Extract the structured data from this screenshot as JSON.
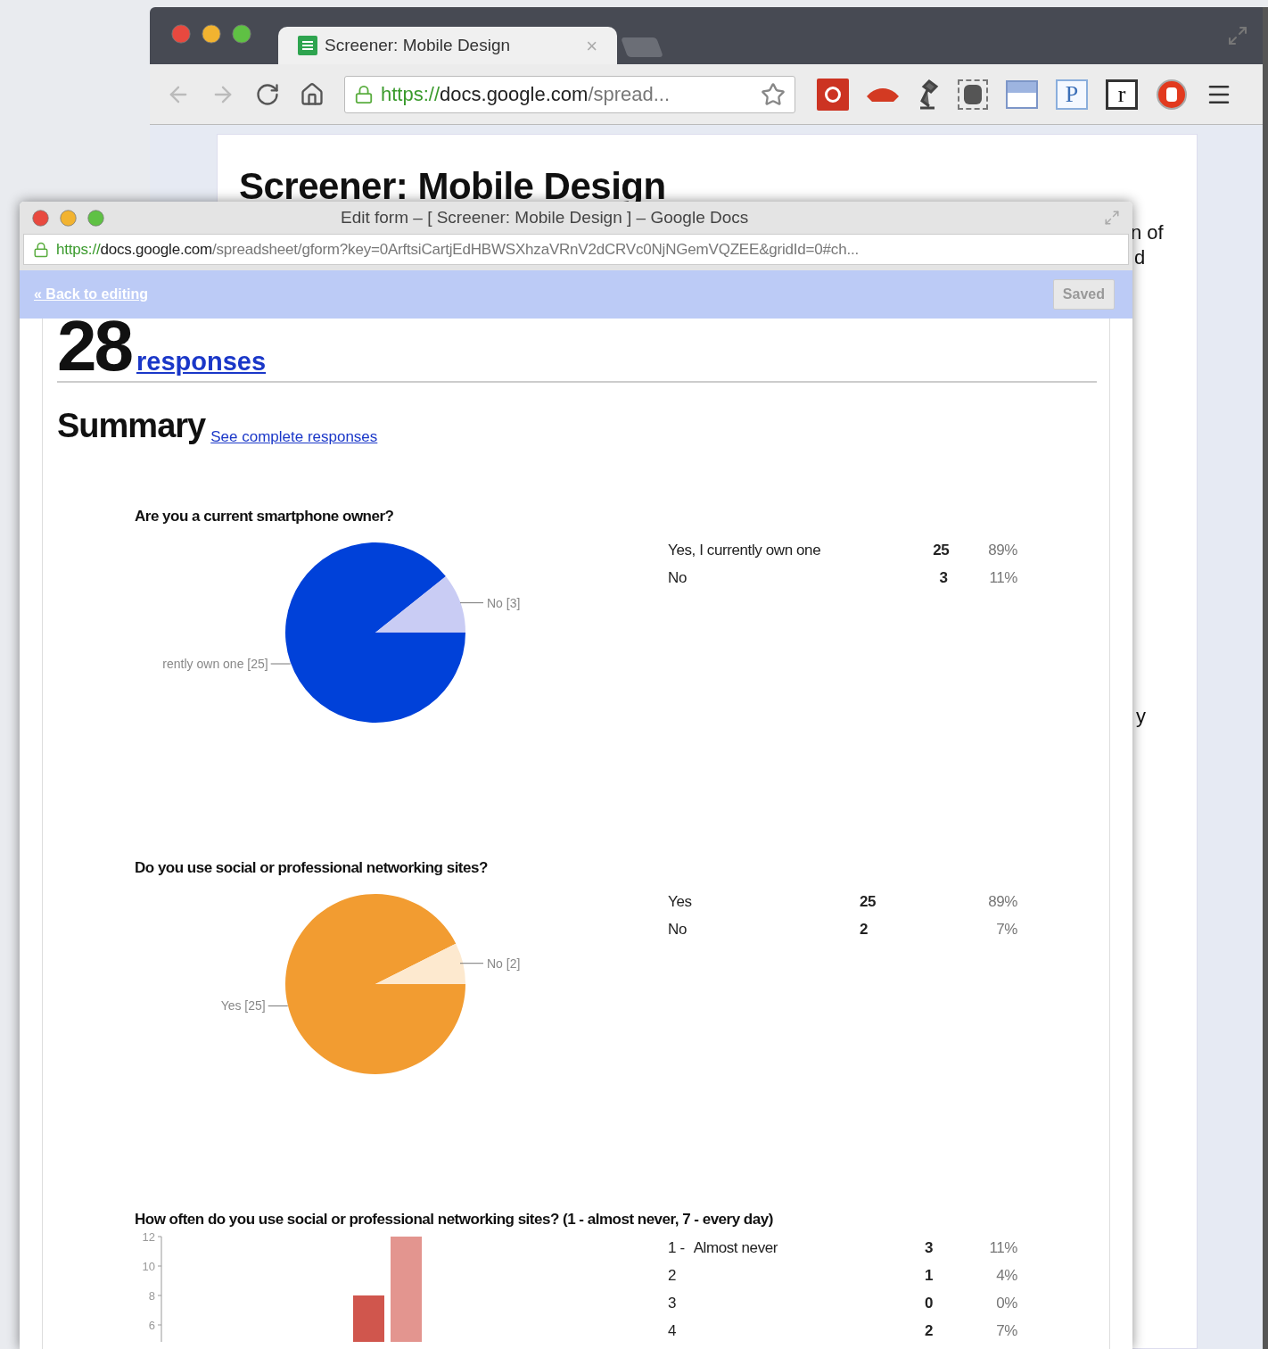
{
  "background_window": {
    "tabs": [
      {
        "title": "Screener: Mobile Design",
        "close": "×",
        "selected": true
      }
    ],
    "address_bar": {
      "scheme": "https://",
      "host": "docs.google.com",
      "path": "/spread..."
    },
    "letter_extensions": [
      "P",
      "r"
    ],
    "page": {
      "title": "Screener: Mobile Design",
      "fragments": [
        "n of",
        "d",
        "y"
      ]
    }
  },
  "form_window": {
    "title": "Edit form – [ Screener: Mobile Design ] – Google Docs",
    "address_bar": {
      "scheme": "https://",
      "host": "docs.google.com",
      "path": "/spreadsheet/gform?key=0ArftsiCartjEdHBWSXhzaVRnV2dCRVc0NjNGemVQZEE&gridId=0#ch..."
    },
    "back_link": "« Back to editing",
    "status_button": "Saved",
    "response_count": "28",
    "responses_link": "responses",
    "summary": {
      "heading": "Summary",
      "link": "See complete responses"
    },
    "questions": [
      {
        "kind": "pie",
        "title": "Are you a current smartphone owner?",
        "slices": [
          {
            "color": "#0041d9"
          },
          {
            "color": "#c9ccf4"
          }
        ],
        "chart_data": {
          "type": "pie",
          "categories": [
            "rently own one [25]",
            "No [3]"
          ],
          "values": [
            25,
            3
          ]
        },
        "rows": [
          {
            "label": "Yes, I currently own one",
            "count": "25",
            "percent": "89%"
          },
          {
            "label": "No",
            "count": "3",
            "percent": "11%"
          }
        ]
      },
      {
        "kind": "pie",
        "title": "Do you use social or professional networking sites?",
        "slices": [
          {
            "color": "#f29c31"
          },
          {
            "color": "#fde9cf"
          }
        ],
        "chart_data": {
          "type": "pie",
          "categories": [
            "Yes [25]",
            "No [2]"
          ],
          "values": [
            25,
            2
          ]
        },
        "rows": [
          {
            "label": "Yes",
            "count": "25",
            "percent": "89%"
          },
          {
            "label": "No",
            "count": "2",
            "percent": "7%"
          }
        ]
      },
      {
        "kind": "bar",
        "title": "How often do you use social or professional networking sites? (1 - almost never, 7 - every day)",
        "bars": [
          {
            "color": "#d0564d"
          },
          {
            "color": "#e3958f"
          }
        ],
        "axis_labels": [
          "12",
          "10",
          "8",
          "6"
        ],
        "rows": [
          {
            "label": "1 -",
            "note": "Almost never",
            "count": "3",
            "percent": "11%"
          },
          {
            "label": "2",
            "count": "1",
            "percent": "4%"
          },
          {
            "label": "3",
            "count": "0",
            "percent": "0%"
          },
          {
            "label": "4",
            "count": "2",
            "percent": "7%"
          }
        ]
      }
    ]
  }
}
